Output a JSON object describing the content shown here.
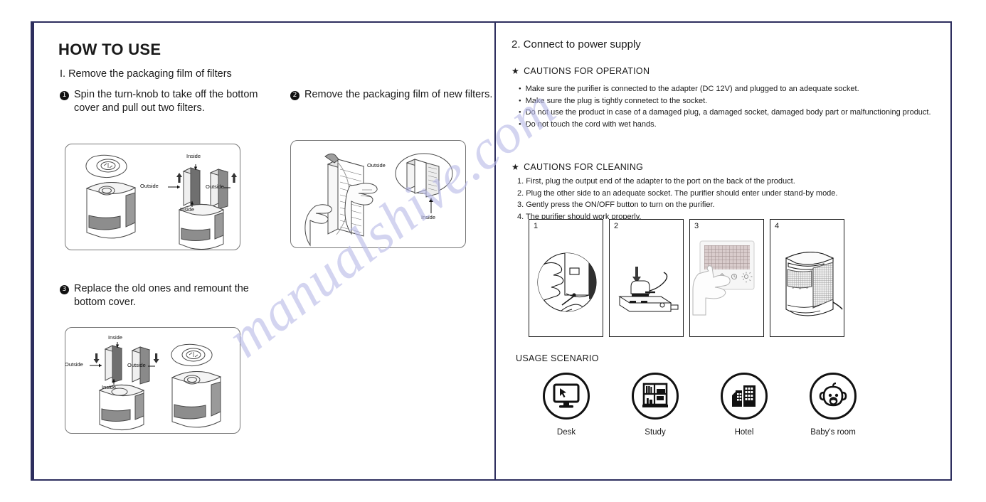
{
  "watermark": "manualshive.com",
  "colors": {
    "border": "#2d2e5e",
    "ink": "#1a1a1a",
    "watermark": "#b9bae8"
  },
  "left_page": {
    "title": "HOW TO USE",
    "section": "I. Remove the packaging film of filters",
    "steps": [
      {
        "num": "1",
        "marker": "1",
        "text": "Spin the turn-knob to take off the bottom",
        "cont": "cover and pull out two filters."
      },
      {
        "num": "2",
        "marker": "2",
        "text": "Remove the packaging film of new filters.",
        "cont": ""
      },
      {
        "num": "3",
        "marker": "3",
        "text": "Replace the old ones and remount the",
        "cont": "bottom cover."
      }
    ],
    "figure1": {
      "name": "purifier-cover-off-with-filters",
      "labels": {
        "inside_top": "Inside",
        "inside_bottom": "Inside",
        "outside_left": "Outside",
        "outside_right": "Outside"
      }
    },
    "figure2": {
      "name": "hands-peeling-film",
      "labels": {
        "outside": "Outside",
        "inside": "Inside"
      }
    },
    "figure3": {
      "name": "reinsert-filters-remount-cover",
      "labels": {
        "inside_top": "Inside",
        "inside_bottom": "Inside",
        "outside_left": "Outside",
        "outside_right": "Outside"
      }
    }
  },
  "right_page": {
    "title": "2. Connect to power supply",
    "cautions_operation": {
      "heading": "CAUTIONS FOR OPERATION",
      "items": [
        "Make sure the purifier is connected to the adapter (DC 12V) and plugged to an adequate socket.",
        "Make sure the plug is tightly connetect to the socket.",
        "Do not use the product in case of a damaged plug, a damaged socket, damaged body part or malfunctioning product.",
        "Do not touch the cord with wet hands."
      ]
    },
    "cautions_cleaning": {
      "heading": "CAUTIONS FOR CLEANING",
      "items": [
        "1. First, plug the output end of the adapter to the port on the back of the product.",
        "2. Plug the other side to an adequate socket. The purifier should enter under stand-by mode.",
        "3. Gently press the ON/OFF button to turn on the purifier.",
        "4. The purifier should work properly."
      ]
    },
    "panels": [
      {
        "number": "1",
        "name": "plug-adapter-into-port"
      },
      {
        "number": "2",
        "name": "plug-into-power-strip"
      },
      {
        "number": "3",
        "name": "press-onoff-control-panel"
      },
      {
        "number": "4",
        "name": "purifier-running"
      }
    ],
    "usage": {
      "title": "USAGE SCENARIO",
      "items": [
        {
          "label": "Desk",
          "icon": "monitor-icon"
        },
        {
          "label": "Study",
          "icon": "bookshelf-icon"
        },
        {
          "label": "Hotel",
          "icon": "buildings-icon"
        },
        {
          "label": "Baby's room",
          "icon": "baby-face-icon"
        }
      ]
    }
  }
}
